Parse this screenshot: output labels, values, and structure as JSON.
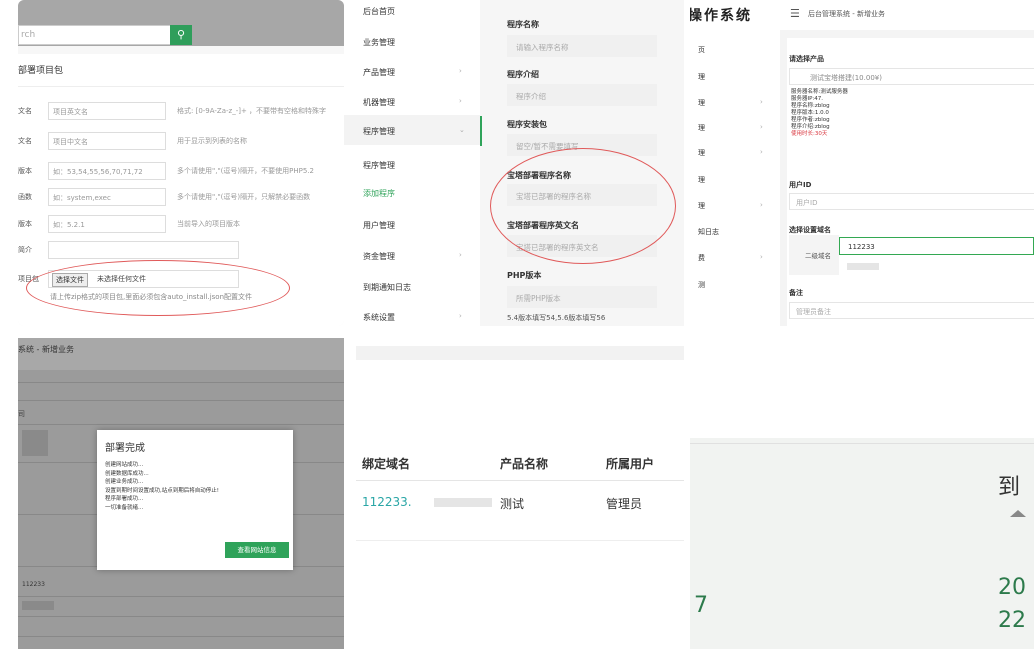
{
  "panel1": {
    "search_placeholder": "rch",
    "search_icon": "search-icon",
    "title": "部署项目包",
    "rows": [
      {
        "label": "文名",
        "value": "项目英文名",
        "hint": "格式: [0-9A-Za-z_-]+ ，不要带有空格和特殊字"
      },
      {
        "label": "文名",
        "value": "项目中文名",
        "hint": "用于显示到列表的名称"
      },
      {
        "label": "版本",
        "value": "如：53,54,55,56,70,71,72",
        "hint": "多个请使用\",\"(逗号)隔开，不要使用PHP5.2"
      },
      {
        "label": "函数",
        "value": "如：system,exec",
        "hint": "多个请使用\",\"(逗号)隔开，只解禁必要函数"
      },
      {
        "label": "版本",
        "value": "如：5.2.1",
        "hint": "当前导入的项目版本"
      },
      {
        "label": "简介",
        "value": "",
        "hint": ""
      }
    ],
    "file_label": "项目包",
    "file_button": "选择文件",
    "file_status": "未选择任何文件",
    "file_hint": "请上传zip格式的项目包,里面必须包含auto_install.json配置文件"
  },
  "panel2": {
    "nav": [
      {
        "label": "后台首页",
        "chev": ""
      },
      {
        "label": "业务管理",
        "chev": ""
      },
      {
        "label": "产品管理",
        "chev": "›"
      },
      {
        "label": "机器管理",
        "chev": "›"
      },
      {
        "label": "程序管理",
        "chev": "⌄"
      },
      {
        "label": "程序管理",
        "chev": ""
      },
      {
        "label": "添加程序",
        "chev": ""
      },
      {
        "label": "用户管理",
        "chev": ""
      },
      {
        "label": "资金管理",
        "chev": "›"
      },
      {
        "label": "到期通知日志",
        "chev": ""
      },
      {
        "label": "系统设置",
        "chev": "›"
      }
    ],
    "fields": [
      {
        "label": "程序名称",
        "placeholder": "请输入程序名称"
      },
      {
        "label": "程序介绍",
        "placeholder": "程序介绍"
      },
      {
        "label": "程序安装包",
        "placeholder": "留空/暂不需要填写"
      },
      {
        "label": "宝塔部署程序名称",
        "placeholder": "宝塔已部署的程序名称"
      },
      {
        "label": "宝塔部署程序英文名",
        "placeholder": "宝塔已部署的程序英文名"
      },
      {
        "label": "PHP版本",
        "placeholder": "所需PHP版本"
      }
    ],
    "php_hint": "5.4版本填写54,5.6版本填写56"
  },
  "panel3": {
    "brand": "操作系统",
    "menu_icon": "menu-icon",
    "breadcrumb": "后台管理系统 - 新增业务",
    "side_items": [
      "页",
      "理",
      "理",
      "理",
      "理",
      "理",
      "理",
      "知日志",
      "费",
      "测"
    ],
    "product_label": "请选择产品",
    "product_value": "测试宝塔搭建(10.00¥)",
    "info_lines": [
      "服务器名称:测试服务器",
      "服务器IP:47.",
      "程序名称:zblog",
      "程序版本:1.0.0",
      "程序作者:zblog",
      "程序介绍:zblog"
    ],
    "expire": "使用时长:30天",
    "userid_label": "用户ID",
    "userid_placeholder": "用户ID",
    "domain_label": "选择设置域名",
    "domain_input": "112233",
    "subdomain_label": "二级域名",
    "note_label": "备注",
    "note_placeholder": "管理员备注"
  },
  "panel4": {
    "breadcrumb": "系统 - 新增业务",
    "side_char": "司",
    "modal_title": "部署完成",
    "modal_lines": [
      "创建网站成功...",
      "创建数据库成功...",
      "创建业务成功...",
      "设置到期时间设置成功,站点到期后将自动停止!",
      "程序部署成功...",
      "一切准备就绪..."
    ],
    "modal_button": "查看网站信息",
    "list_value": "112233"
  },
  "panel5": {
    "headers": [
      "绑定域名",
      "产品名称",
      "所属用户"
    ],
    "row": [
      "112233.",
      "测试",
      "管理员"
    ]
  },
  "panel6": {
    "heading": "到",
    "left_num": "7",
    "right_nums": [
      "20",
      "22"
    ]
  }
}
